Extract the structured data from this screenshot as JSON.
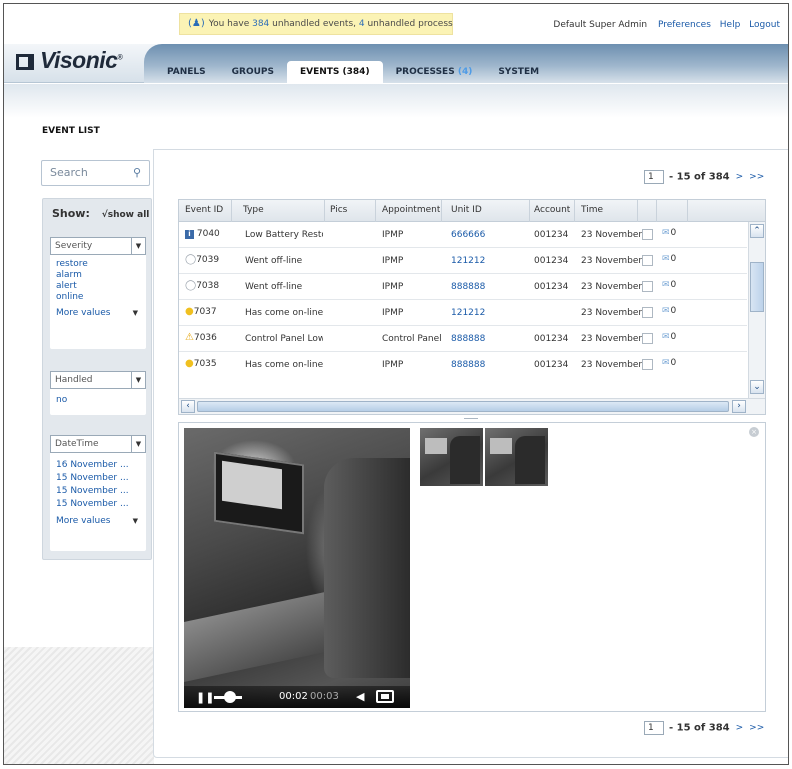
{
  "header": {
    "notification_prefix": "You have ",
    "unhandled_events": "384",
    "notification_middle": " unhandled events, ",
    "unhandled_processes": "4",
    "notification_suffix": " unhandled process",
    "user": "Default Super Admin",
    "links": [
      "Preferences",
      "Help",
      "Logout"
    ]
  },
  "brand": {
    "logo": "Visonic"
  },
  "nav": {
    "tabs": [
      {
        "label": "PANELS"
      },
      {
        "label": "GROUPS"
      },
      {
        "label": "EVENTS (384)"
      },
      {
        "label": "PROCESSES",
        "count": "(4)"
      },
      {
        "label": "SYSTEM"
      }
    ],
    "active": "EVENTS (384)"
  },
  "page": {
    "title": "EVENT LIST"
  },
  "sidebar": {
    "search_placeholder": "Search",
    "show_label": "Show:",
    "show_all": "√show all",
    "severity": {
      "label": "Severity",
      "values": [
        "restore",
        "alarm",
        "alert",
        "online"
      ],
      "more": "More values"
    },
    "handled": {
      "label": "Handled",
      "values": [
        "no"
      ]
    },
    "datetime": {
      "label": "DateTime",
      "values": [
        "16 November ...",
        "15 November ...",
        "15 November ...",
        "15 November ..."
      ],
      "more": "More values"
    }
  },
  "pager": {
    "page": "1",
    "range": "- 15 of 384",
    "next": ">",
    "last": ">>"
  },
  "table": {
    "columns": [
      "Event ID",
      "Type",
      "Pics",
      "Appointment",
      "Unit ID",
      "Account",
      "Time"
    ],
    "rows": [
      {
        "icon": "info-icon",
        "id": "7040",
        "type": "Low Battery Restor",
        "appointment": "IPMP",
        "unit": "666666",
        "account": "001234",
        "time": "23 November",
        "mail_count": "0"
      },
      {
        "icon": "bulb-off-icon",
        "id": "7039",
        "type": "Went off-line",
        "appointment": "IPMP",
        "unit": "121212",
        "account": "001234",
        "time": "23 November",
        "mail_count": "0"
      },
      {
        "icon": "bulb-off-icon",
        "id": "7038",
        "type": "Went off-line",
        "appointment": "IPMP",
        "unit": "888888",
        "account": "001234",
        "time": "23 November",
        "mail_count": "0"
      },
      {
        "icon": "bulb-on-icon",
        "id": "7037",
        "type": "Has come on-line",
        "appointment": "IPMP",
        "unit": "121212",
        "account": "",
        "time": "23 November",
        "mail_count": "0"
      },
      {
        "icon": "warning-icon",
        "id": "7036",
        "type": "Control Panel Low E",
        "appointment": "Control Panel",
        "unit": "888888",
        "account": "001234",
        "time": "23 November",
        "mail_count": "0"
      },
      {
        "icon": "bulb-on-icon",
        "id": "7035",
        "type": "Has come on-line",
        "appointment": "IPMP",
        "unit": "888888",
        "account": "001234",
        "time": "23 November",
        "mail_count": "0"
      }
    ]
  },
  "video": {
    "current_time": "00:02",
    "duration": "00:03"
  }
}
